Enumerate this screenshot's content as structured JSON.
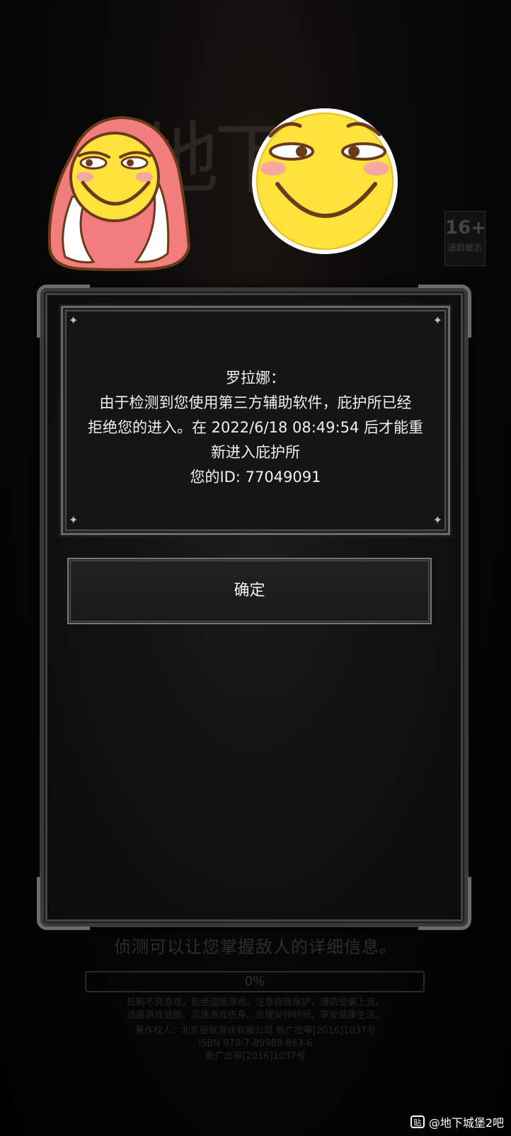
{
  "background": {
    "logo_text": "地下城",
    "rating_number": "16+",
    "rating_label": "适龄提示"
  },
  "dialog": {
    "speaker": "罗拉娜：",
    "lines": [
      "由于检测到您使用第三方辅助软件，庇护所已经",
      "拒绝您的进入。在 2022/6/18 08:49:54 后才能重",
      "新进入庇护所"
    ],
    "id_line": "您的ID: 77049091",
    "confirm_label": "确定"
  },
  "loading": {
    "tip": "侦测可以让您掌握敌人的详细信息。",
    "progress_fraction": 0,
    "progress_label": "0%",
    "notices": [
      "抵制不良游戏，拒绝盗版游戏。注意自我保护，谨防受骗上当。",
      "适度游戏益脑，沉迷游戏伤身。合理安排时间，享受健康生活。",
      "著作权人：北京极致游戏有限公司 新广出审[2016]1037号",
      "ISBN 978-7-89988-863-6",
      "新广出审[2016]1037号"
    ]
  },
  "watermark": {
    "icon_label": "贴",
    "text": "@地下城堡2吧"
  },
  "colors": {
    "emoji_face": "#ffe23c",
    "blanket": "#f27d7d",
    "outline": "#6b3a1a"
  }
}
